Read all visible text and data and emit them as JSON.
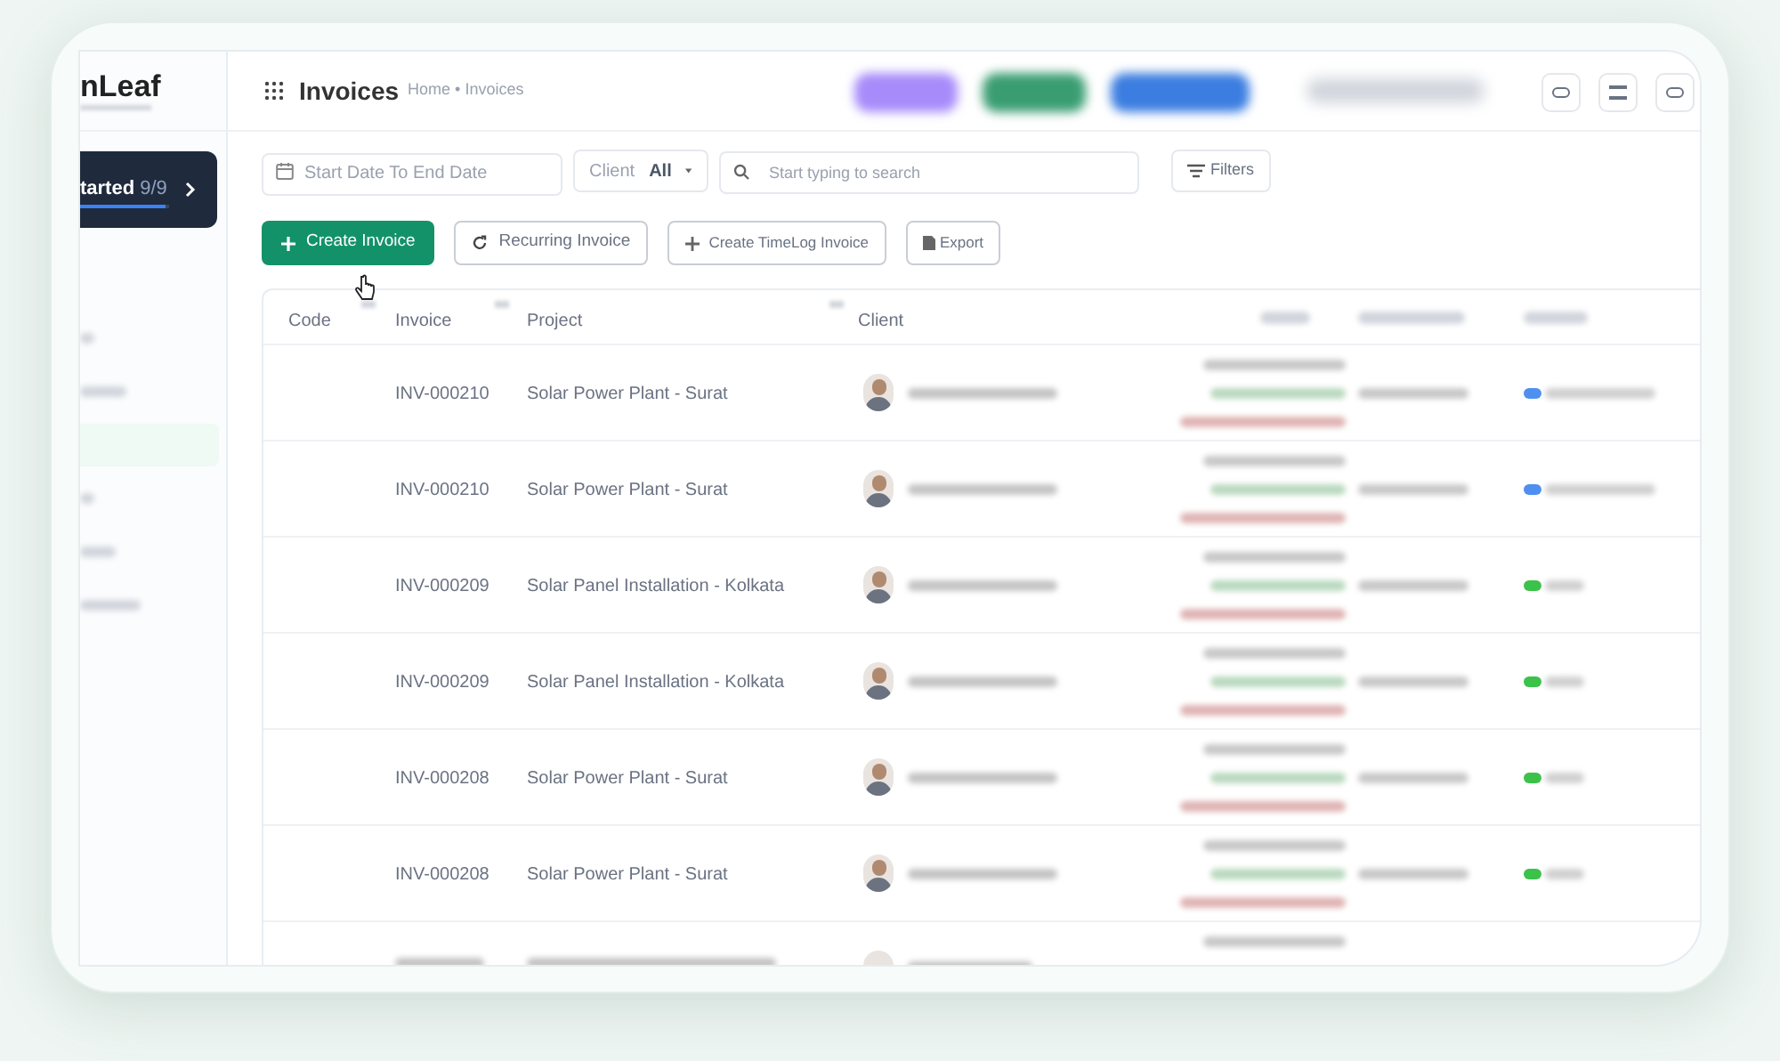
{
  "sidebar": {
    "logo": "nLeaf",
    "getting_started": {
      "label": "tarted",
      "count": "9/9",
      "level": 0.95
    },
    "items": [
      {
        "selected": false
      },
      {
        "selected": false
      },
      {
        "selected": true
      },
      {
        "selected": false
      },
      {
        "selected": false
      },
      {
        "selected": false
      }
    ]
  },
  "header": {
    "title": "Invoices",
    "breadcrumb": "Home • Invoices"
  },
  "filters": {
    "date_range": {
      "placeholder": "Start Date To End Date"
    },
    "client": {
      "label": "Client",
      "value": "All"
    },
    "search": {
      "placeholder": "Start typing to search"
    },
    "filters_button": "Filters"
  },
  "actions": [
    {
      "label": "Create Invoice",
      "kind": "primary"
    },
    {
      "label": "Recurring Invoice",
      "kind": "recurring"
    },
    {
      "label": "Create TimeLog Invoice",
      "kind": "add"
    },
    {
      "label": "Export",
      "kind": "export"
    }
  ],
  "table": {
    "columns": [
      "Code",
      "Invoice",
      "Project",
      "Client"
    ],
    "rows": [
      {
        "invoice": "INV-000210",
        "project": "Solar Power Plant - Surat",
        "color": "#4f8ff0"
      },
      {
        "invoice": "INV-000210",
        "project": "Solar Power Plant - Surat",
        "color": "#4f8ff0"
      },
      {
        "invoice": "INV-000209",
        "project": "Solar Panel Installation - Kolkata",
        "color": "#3cc24a"
      },
      {
        "invoice": "INV-000209",
        "project": "Solar Panel Installation - Kolkata",
        "color": "#3cc24a"
      },
      {
        "invoice": "INV-000208",
        "project": "Solar Power Plant - Surat",
        "color": "#3cc24a"
      },
      {
        "invoice": "INV-000208",
        "project": "Solar Power Plant - Surat",
        "color": "#3cc24a"
      }
    ]
  }
}
